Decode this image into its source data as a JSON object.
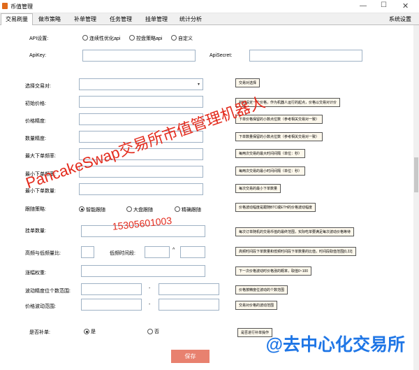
{
  "window": {
    "title": "币值管理",
    "min": "—",
    "max": "☐",
    "close": "✕"
  },
  "tabs": [
    {
      "label": "交易刷量"
    },
    {
      "label": "做市策略"
    },
    {
      "label": "补单管理"
    },
    {
      "label": "任务管理"
    },
    {
      "label": "挂单管理"
    },
    {
      "label": "统计分析"
    }
  ],
  "settings_tab": "系统设置",
  "api": {
    "label": "API设置:",
    "options": [
      "连续性优化api",
      "控盘策略api",
      "自定义"
    ],
    "key_label": "ApiKey:",
    "secret_label": "ApiSecret:",
    "key_value": "",
    "secret_value": ""
  },
  "fields": [
    {
      "label": "选择交易对:",
      "tip": "交易对选择"
    },
    {
      "label": "初始价格:",
      "tip": "初始设定一个价格，作为机器人运行的起点，价格以交易对计价"
    },
    {
      "label": "价格精度:",
      "tip": "下单价格保留的小数点位数（参考相关交易对一致）"
    },
    {
      "label": "数量精度:",
      "tip": "下单数量保留的小数点位数（参考相关交易对一致）"
    },
    {
      "label": "最大下单频率:",
      "tip": "每两次交易的最大时间间隔（单位：秒）"
    },
    {
      "label": "最小下单频率:",
      "tip": "每两次交易的最小时间间隔（单位：秒）"
    },
    {
      "label": "最小下单数量:",
      "tip": "每次交易的最小下单数量"
    }
  ],
  "strategy": {
    "label": "跟随策略:",
    "options": [
      "智能跟随",
      "大盘跟随",
      "精确跟随"
    ],
    "tip": "价格波动幅度是跟随BTC或ETH的价格波动幅度"
  },
  "order_qty": {
    "label": "挂单数量:",
    "tip": "每次订单随机的交易币值的最终范围，实际吃单要满足每次波动价格等待"
  },
  "ratio": {
    "label": "高频与低频量比:",
    "interval_label": "低频时间段:",
    "sep": "^",
    "tip": "高频时间段下单数量和低频时间段下单数量的比值，时间段取值范围[0,22]"
  },
  "weight": {
    "label": "涨幅权重:",
    "tip": "下一次价格波动时价格涨的概率，取值0~100"
  },
  "wave_digits": {
    "label": "波动精度位个数范围:",
    "sep": "-",
    "tip": "价格按精度位波动的个数范围"
  },
  "wave_range": {
    "label": "价格波动范围:",
    "sep": "-",
    "tip": "交易对价格的波动范围"
  },
  "refill": {
    "label": "是否补单:",
    "yes": "是",
    "no": "否",
    "tip": "是否进行补单操作"
  },
  "save_label": "保存",
  "watermarks": {
    "main": "PancakeSwap交易所市值管理机器人",
    "phone": "15305601003",
    "brand": "@去中心化交易所"
  },
  "colors": {
    "accent": "#e32b1d",
    "brand": "#1f76e6",
    "save": "#e8816f"
  }
}
